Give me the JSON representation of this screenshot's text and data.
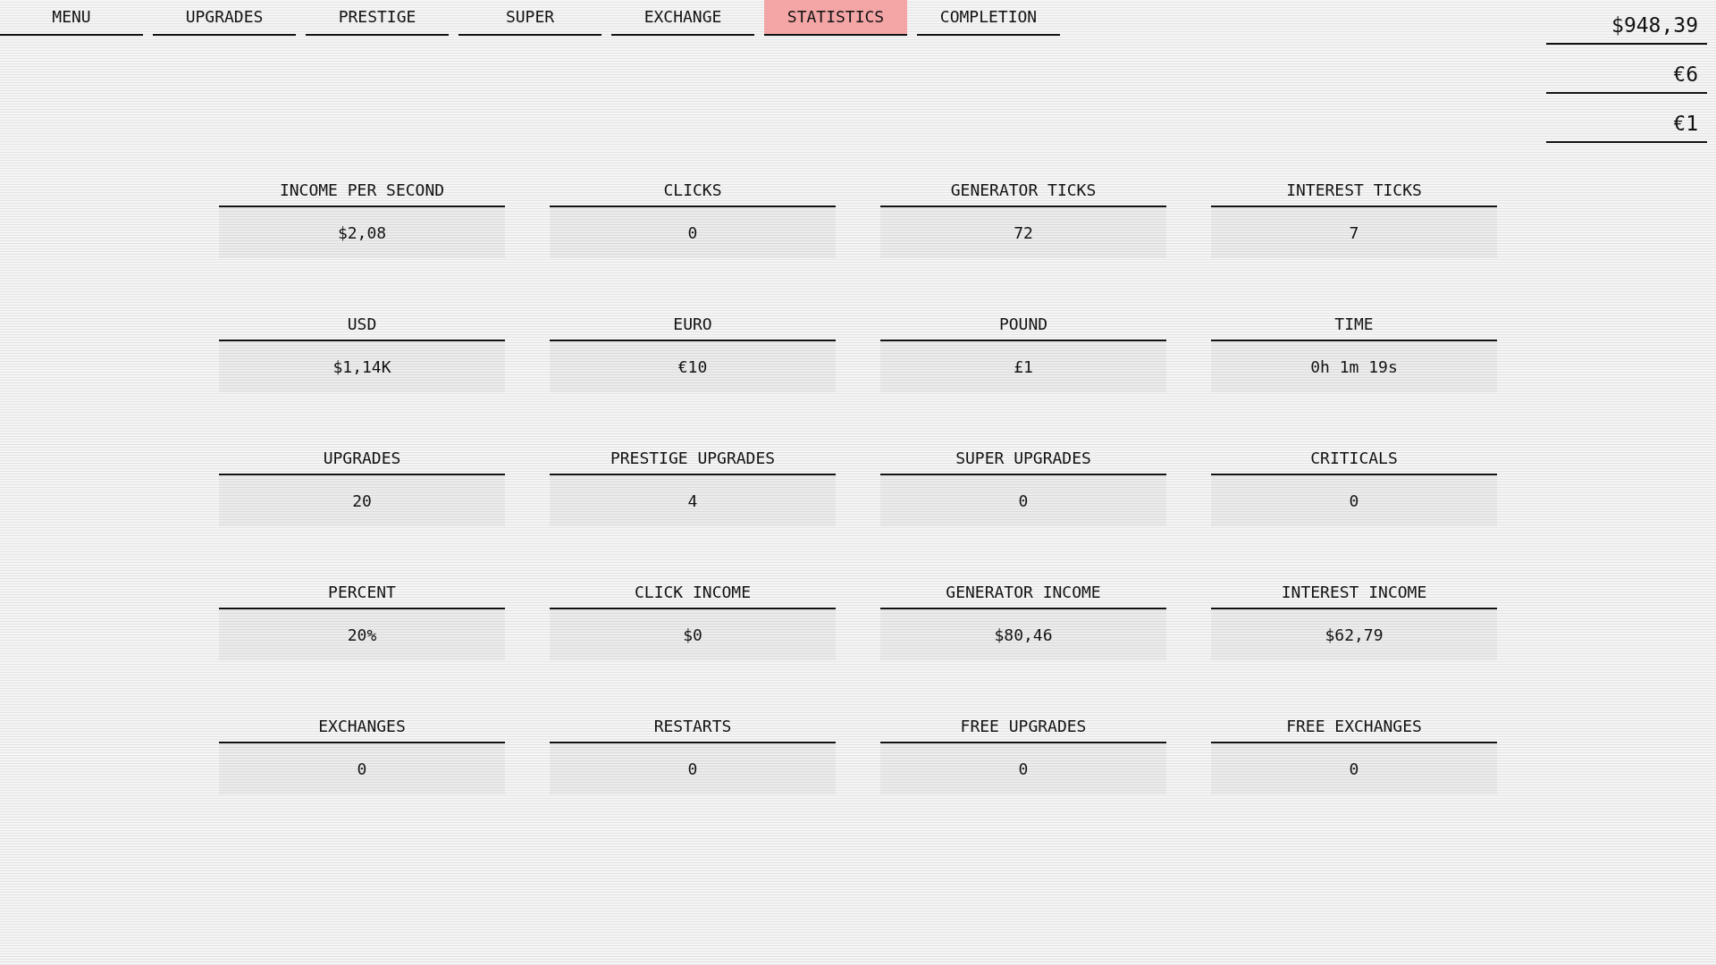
{
  "nav": {
    "tabs": [
      {
        "label": "MENU",
        "selected": false
      },
      {
        "label": "UPGRADES",
        "selected": false
      },
      {
        "label": "PRESTIGE",
        "selected": false
      },
      {
        "label": "SUPER",
        "selected": false
      },
      {
        "label": "EXCHANGE",
        "selected": false
      },
      {
        "label": "STATISTICS",
        "selected": true
      },
      {
        "label": "COMPLETION",
        "selected": false
      }
    ]
  },
  "balances": [
    "$948,39",
    "€6",
    "€1"
  ],
  "stats": [
    {
      "label": "INCOME PER SECOND",
      "value": "$2,08"
    },
    {
      "label": "CLICKS",
      "value": "0"
    },
    {
      "label": "GENERATOR TICKS",
      "value": "72"
    },
    {
      "label": "INTEREST TICKS",
      "value": "7"
    },
    {
      "label": "USD",
      "value": "$1,14K"
    },
    {
      "label": "EURO",
      "value": "€10"
    },
    {
      "label": "POUND",
      "value": "£1"
    },
    {
      "label": "TIME",
      "value": "0h 1m 19s"
    },
    {
      "label": "UPGRADES",
      "value": "20"
    },
    {
      "label": "PRESTIGE UPGRADES",
      "value": "4"
    },
    {
      "label": "SUPER UPGRADES",
      "value": "0"
    },
    {
      "label": "CRITICALS",
      "value": "0"
    },
    {
      "label": "PERCENT",
      "value": "20%"
    },
    {
      "label": "CLICK INCOME",
      "value": "$0"
    },
    {
      "label": "GENERATOR INCOME",
      "value": "$80,46"
    },
    {
      "label": "INTEREST INCOME",
      "value": "$62,79"
    },
    {
      "label": "EXCHANGES",
      "value": "0"
    },
    {
      "label": "RESTARTS",
      "value": "0"
    },
    {
      "label": "FREE UPGRADES",
      "value": "0"
    },
    {
      "label": "FREE EXCHANGES",
      "value": "0"
    }
  ]
}
